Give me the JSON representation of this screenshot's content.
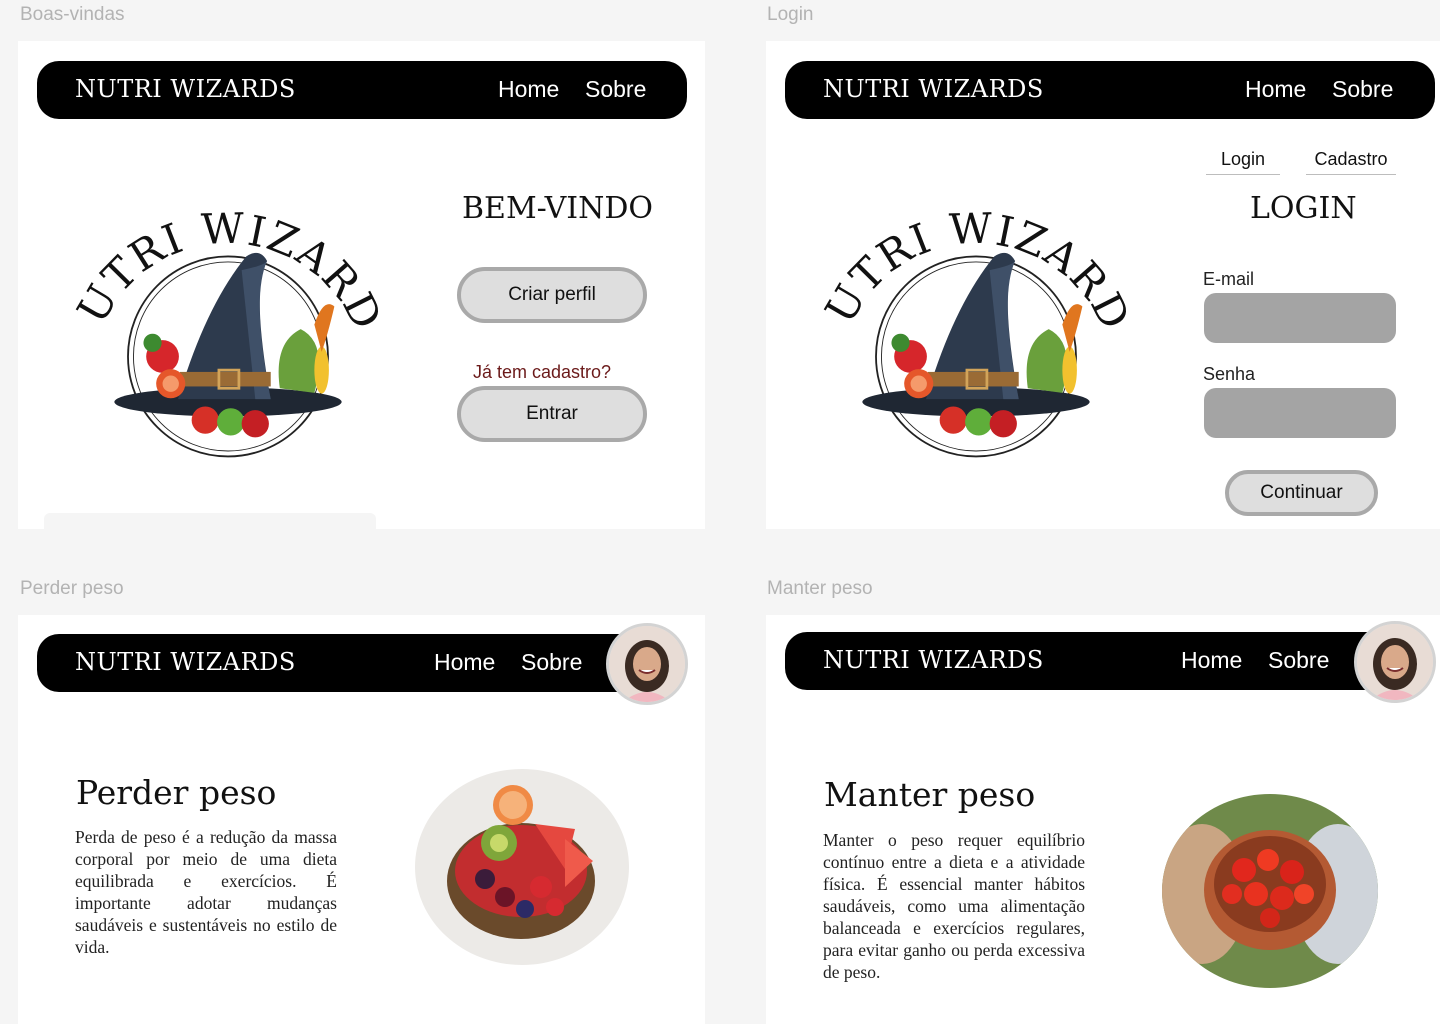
{
  "frames": {
    "welcome": {
      "label": "Boas-vindas"
    },
    "login": {
      "label": "Login"
    },
    "lose": {
      "label": "Perder peso"
    },
    "maintain": {
      "label": "Manter peso"
    }
  },
  "nav": {
    "brand": "NUTRI WIZARDS",
    "home": "Home",
    "about": "Sobre"
  },
  "logo": {
    "text": "NUTRI WIZARDS"
  },
  "welcome": {
    "title": "BEM-VINDO",
    "create_profile": "Criar perfil",
    "have_account": "Já tem cadastro?",
    "enter": "Entrar"
  },
  "login": {
    "tab_login": "Login",
    "tab_signup": "Cadastro",
    "title": "LOGIN",
    "email_label": "E-mail",
    "password_label": "Senha",
    "continue": "Continuar"
  },
  "lose": {
    "title": "Perder peso",
    "text": "Perda de peso é a redução da massa corporal por meio de uma dieta equilibrada e exercícios. É importante adotar mudanças saudáveis e sustentáveis no estilo de vida."
  },
  "maintain": {
    "title": "Manter peso",
    "text": "Manter o peso requer equilíbrio contínuo entre a dieta e a atividade física. É essencial manter hábitos saudáveis, como uma alimentação balanceada e exercícios regulares, para evitar ganho ou perda excessiva de peso."
  },
  "colors": {
    "nav_bg": "#000000",
    "accent_text": "#6b1a1a",
    "button_bg": "#dedede",
    "field_bg": "#a4a4a4"
  }
}
